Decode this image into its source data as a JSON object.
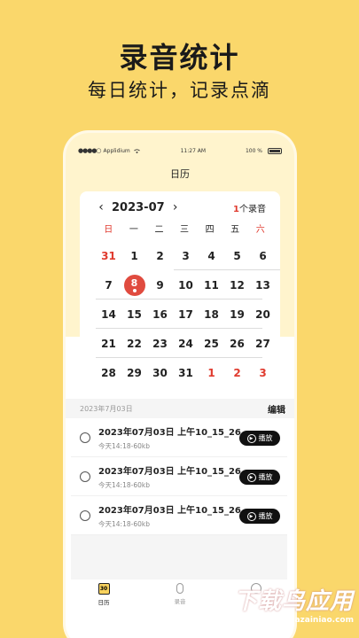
{
  "promo": {
    "title": "录音统计",
    "subtitle": "每日统计，记录点滴"
  },
  "statusbar": {
    "carrier": "Applidium",
    "time": "11:27 AM",
    "battery": "100 %"
  },
  "nav": {
    "title": "日历"
  },
  "calendar": {
    "month": "2023-07",
    "count_num": "1",
    "count_suffix": "个录音",
    "weekdays": [
      "日",
      "一",
      "二",
      "三",
      "四",
      "五",
      "六"
    ],
    "rows": [
      [
        "31",
        "1",
        "2",
        "3",
        "4",
        "5",
        "6"
      ],
      [
        "7",
        "8",
        "9",
        "10",
        "11",
        "12",
        "13"
      ],
      [
        "14",
        "15",
        "16",
        "17",
        "18",
        "19",
        "20"
      ],
      [
        "21",
        "22",
        "23",
        "24",
        "25",
        "26",
        "27"
      ],
      [
        "28",
        "29",
        "30",
        "31",
        "1",
        "2",
        "3"
      ]
    ],
    "selected": "8"
  },
  "list_header": {
    "date": "2023年7月03日",
    "edit": "编辑"
  },
  "recordings": [
    {
      "title": "2023年07月03日 上午10_15_26",
      "meta": "今天14:18-60kb",
      "play": "播放"
    },
    {
      "title": "2023年07月03日 上午10_15_26",
      "meta": "今天14:18-60kb",
      "play": "播放"
    },
    {
      "title": "2023年07月03日 上午10_15_26",
      "meta": "今天14:18-60kb",
      "play": "播放"
    }
  ],
  "tabs": [
    {
      "label": "日历",
      "icon": "calendar-icon",
      "badge": "30"
    },
    {
      "label": "录音",
      "icon": "mic-icon"
    },
    {
      "label": "",
      "icon": "user-icon"
    }
  ],
  "watermark": {
    "big": "下载鸟应用",
    "small": "www.xiazainiao.com"
  }
}
